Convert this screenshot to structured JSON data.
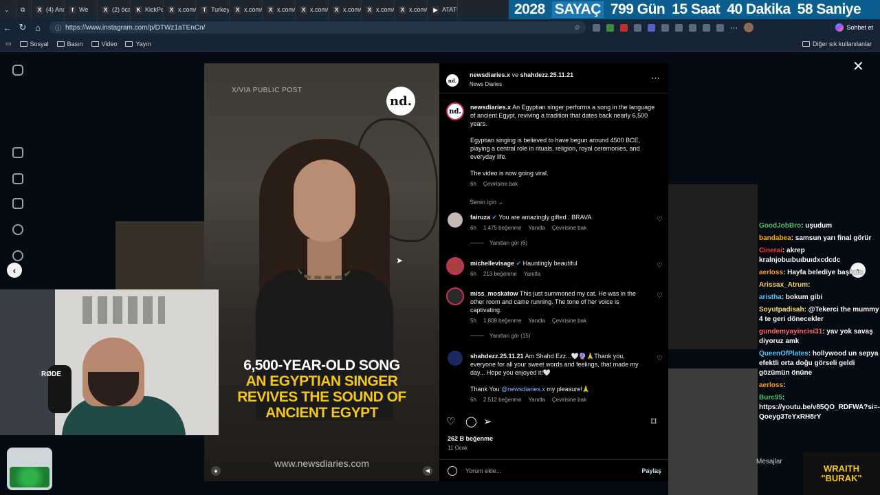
{
  "tabs": [
    {
      "icon": "X",
      "label": "(4) Ana"
    },
    {
      "icon": "f",
      "label": "We"
    },
    {
      "icon": "X",
      "label": "(2) öca"
    },
    {
      "icon": "K",
      "label": "KickPer"
    },
    {
      "icon": "X",
      "label": "x.com/"
    },
    {
      "icon": "T",
      "label": "Turkey"
    },
    {
      "icon": "X",
      "label": "x.com/"
    },
    {
      "icon": "X",
      "label": "x.com/"
    },
    {
      "icon": "X",
      "label": "x.com/"
    },
    {
      "icon": "X",
      "label": "x.com/"
    },
    {
      "icon": "X",
      "label": "x.com/"
    },
    {
      "icon": "X",
      "label": "x.com/"
    },
    {
      "icon": "▶",
      "label": "ATATÜR"
    }
  ],
  "counter": {
    "year": "2028",
    "label": "SAYAÇ",
    "days": "799 Gün",
    "hours": "15 Saat",
    "minutes": "40 Dakika",
    "seconds": "58 Saniye"
  },
  "browser": {
    "url": "https://www.instagram.com/p/DTWz1aTEnCn/",
    "chat_button": "Sohbet et"
  },
  "bookmarks": [
    "Sosyal",
    "Basın",
    "Video",
    "Yayın"
  ],
  "bookmarks_right": "Diğer sık kullanılanlar",
  "video": {
    "via": "X/VIA PUBLIC POST",
    "logo": "nd.",
    "title_white": "6,500-YEAR-OLD SONG",
    "title_yellow": [
      "AN EGYPTIAN SINGER",
      "REVIVES THE SOUND OF",
      "ANCIENT EGYPT"
    ],
    "site": "www.newsdiaries.com"
  },
  "post": {
    "header_users": "newsdiaries.x",
    "header_and": "ve",
    "header_user2": "shahdezz.25.11.21",
    "header_sub": "News Diaries",
    "caption_user": "newsdiaries.x",
    "caption_p1": "An Egyptian singer performs a song in the language of ancient Egypt, reviving a tradition that dates back nearly 6,500 years.",
    "caption_p2": "Egyptian singing is believed to have begun around 4500 BCE, playing a central role in rituals, religion, royal ceremonies, and everyday life.",
    "caption_p3": "The video is now going viral.",
    "caption_time": "6h",
    "see_translation": "Çevirisine bak",
    "for_you": "Senin için",
    "likes": "262 B beğenme",
    "date": "11 Ocak",
    "add_comment": "Yorum ekle...",
    "share": "Paylaş"
  },
  "comments": [
    {
      "user": "fairuza",
      "verified": true,
      "text": "You are amazingly gifted . BRAVA",
      "time": "6h",
      "likes": "1.475 beğenme",
      "reply": "Yanıtla",
      "translate": "Çevirisine bak",
      "replies": "Yanıtları gör (6)"
    },
    {
      "user": "michellevisage",
      "verified": true,
      "text": "Hauntingly beautiful",
      "time": "6h",
      "likes": "213 beğenme",
      "reply": "Yanıtla"
    },
    {
      "user": "miss_moskatow",
      "text": "This just summoned my cat. He was in the other room and came running. The tone of her voice is captivating.",
      "time": "5h",
      "likes": "1.808 beğenme",
      "reply": "Yanıtla",
      "translate": "Çevirisine bak",
      "replies": "Yanıtları gör (15)"
    },
    {
      "user": "shahdezz.25.11.21",
      "text": "Am Shahd Ezz...🤍🔮🙏Thank you, everyone for all your sweet words and feelings, that made my day... Hope you enjoyed it!🤍",
      "text2_pre": "Thank You",
      "mention": "@newsdiaries.x",
      "text2_post": "my pleasure!🙏",
      "time": "6h",
      "likes": "2.512 beğenme",
      "reply": "Yanıtla",
      "translate": "Çevirisine bak"
    }
  ],
  "chat": [
    {
      "user": "GoodJobBro",
      "text": "uşudum"
    },
    {
      "user": "bandabea",
      "text": "samsun yarı final görür"
    },
    {
      "user": "Cinerai",
      "text": "akrep kralnjobuıbuıbuıdxcdcdc"
    },
    {
      "user": "aerloss",
      "text": "Hayfa belediye başkanı"
    },
    {
      "user": "Arissax_Atrum",
      "text": ""
    },
    {
      "user": "aristha",
      "text": "bokum gibi"
    },
    {
      "user": "Soyutpadisah",
      "text": "@Tekerci the mummy 4 te geri dönecekler"
    },
    {
      "user": "gundemyayincisi31",
      "text": "yav yok savaş diyoruz amk"
    },
    {
      "user": "QueenOfPlates",
      "text": "hollywood un sepya efektli orta doğu görseli geldi gözümün önüne"
    },
    {
      "user": "aerloss",
      "text": ""
    },
    {
      "user": "Burc95",
      "text": "https://youtu.be/v85QO_RDFWA?si=-Qoeyg3TeYxRH8rY"
    }
  ],
  "messages_label": "Mesajlar",
  "brand": [
    "WRAITH",
    "\"BURAK\""
  ],
  "cam_label": "RØDE"
}
